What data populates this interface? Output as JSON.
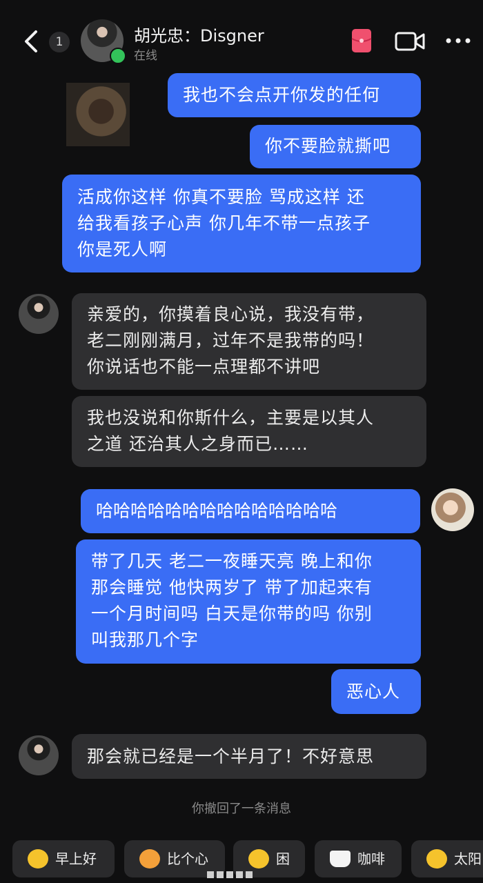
{
  "header": {
    "unread_count": "1",
    "contact_name": "胡光忠：Disgner",
    "status": "在线",
    "icons": [
      "back-icon",
      "pocket-icon",
      "video-call-icon",
      "more-icon"
    ]
  },
  "messages": [
    {
      "side": "out",
      "text": "我也不会点开你发的任何"
    },
    {
      "side": "out",
      "text": "你不要脸就撕吧"
    },
    {
      "side": "out",
      "text": "活成你这样 你真不要脸 骂成这样 还\n给我看孩子心声 你几年不带一点孩子\n你是死人啊"
    },
    {
      "side": "in",
      "text": "亲爱的，你摸着良心说，我没有带，\n老二刚刚满月，过年不是我带的吗！\n你说话也不能一点理都不讲吧"
    },
    {
      "side": "in",
      "text": "我也没说和你斯什么，主要是以其人\n之道 还治其人之身而已……"
    },
    {
      "side": "out",
      "text": "哈哈哈哈哈哈哈哈哈哈哈哈哈哈"
    },
    {
      "side": "out",
      "text": "带了几天 老二一夜睡天亮 晚上和你\n那会睡觉 他快两岁了 带了加起来有\n一个月时间吗 白天是你带的吗 你别\n叫我那几个字"
    },
    {
      "side": "out",
      "text": "恶心人"
    },
    {
      "side": "in",
      "text": "那会就已经是一个半月了！不好意思"
    }
  ],
  "recall_notice": "你撤回了一条消息",
  "quick_replies": [
    "早上好",
    "比个心",
    "困",
    "咖啡",
    "太阳"
  ],
  "colors": {
    "background": "#0f0f10",
    "outgoing_bubble": "#3a6df5",
    "incoming_bubble": "#2f2f31",
    "online": "#33c35a"
  }
}
